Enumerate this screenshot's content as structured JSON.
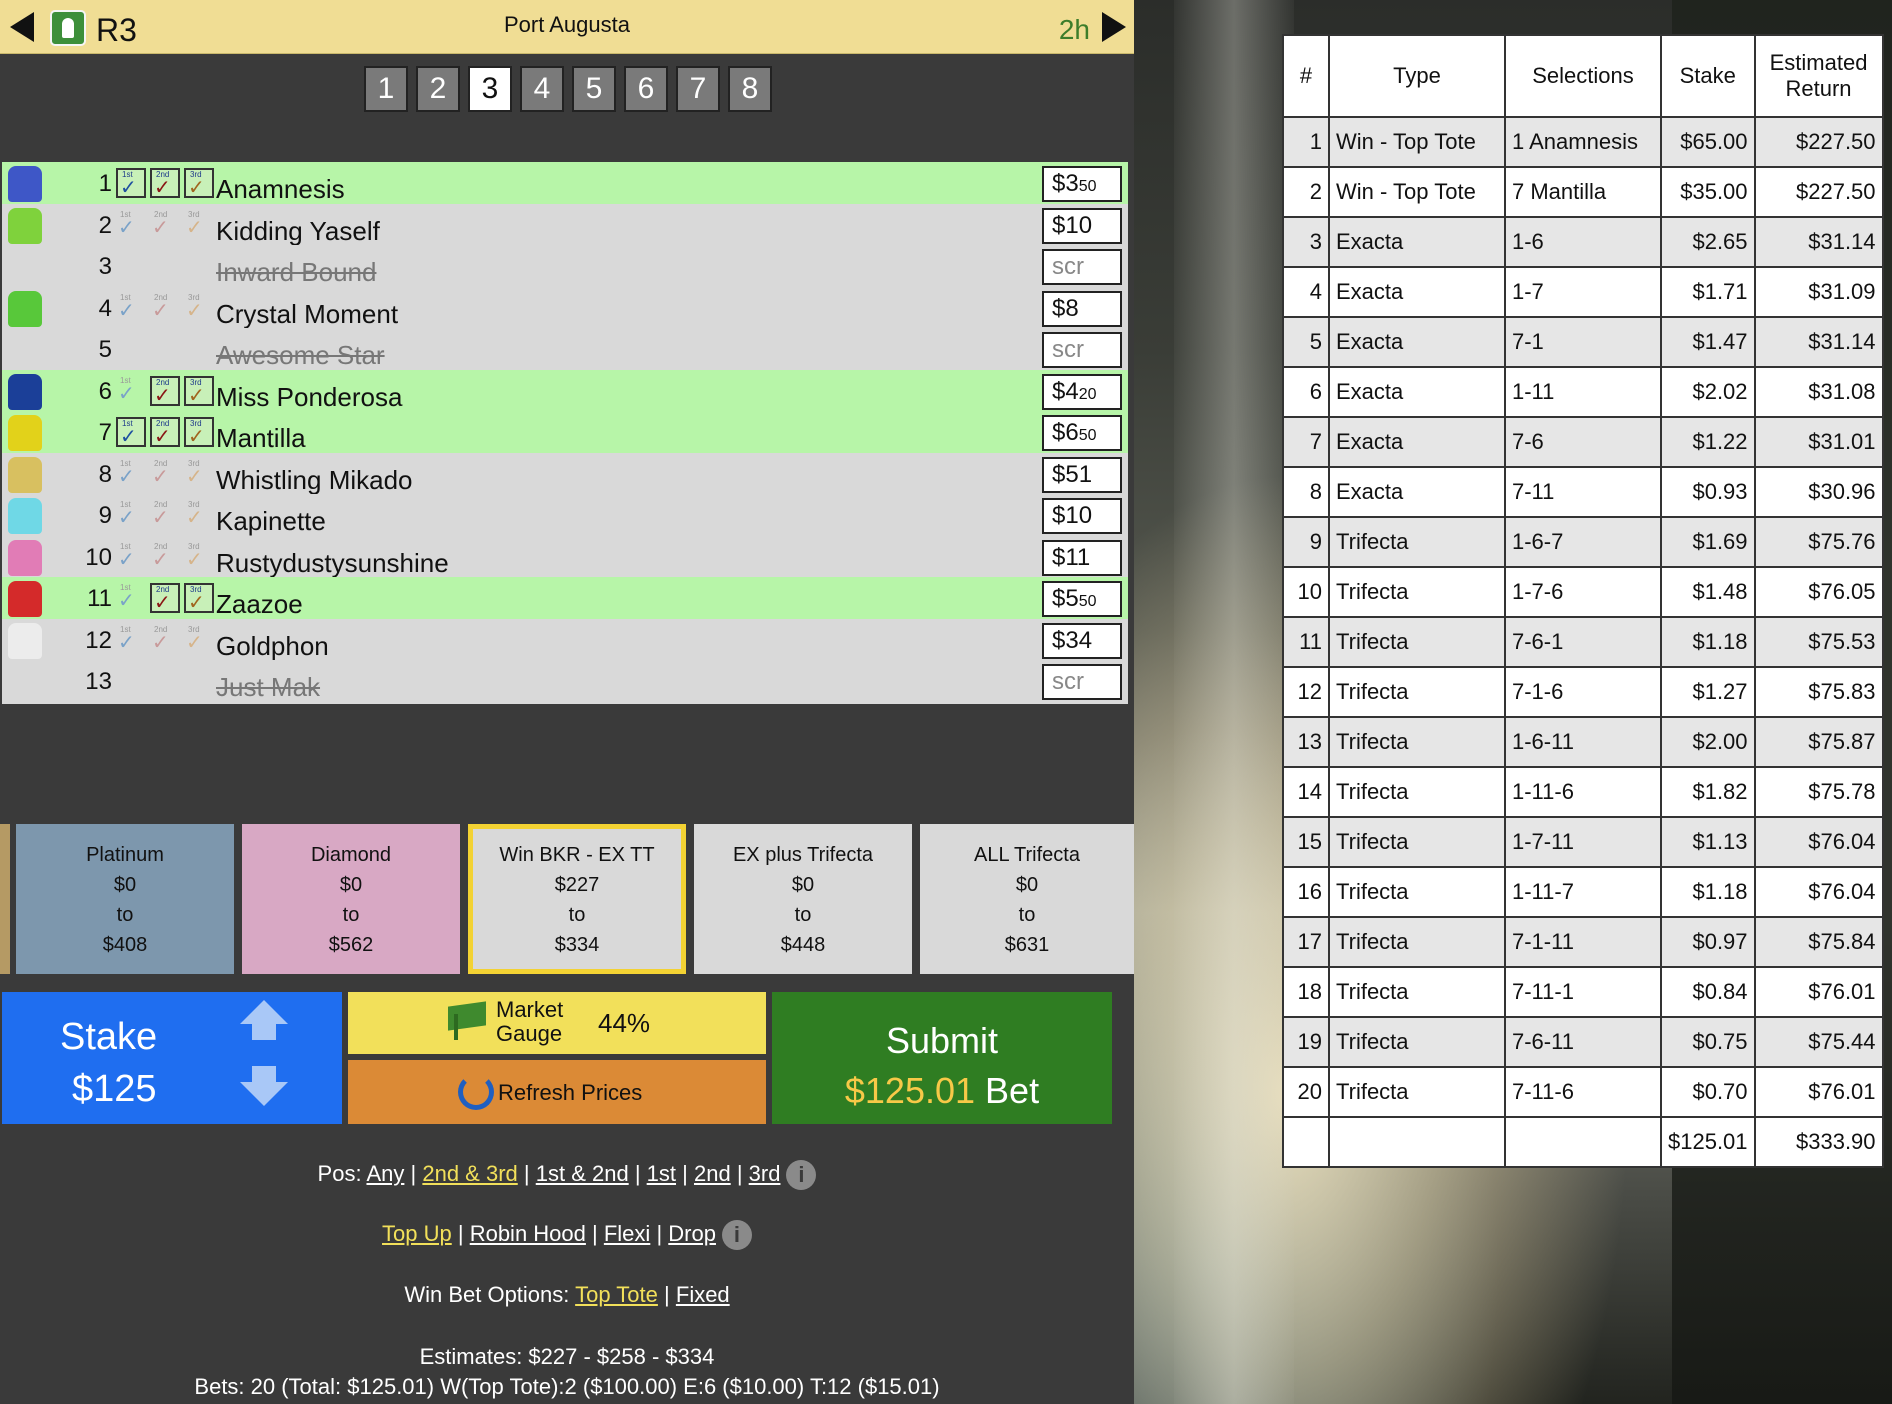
{
  "header": {
    "race_label": "R3",
    "venue": "Port Augusta",
    "time_to_start": "2h"
  },
  "race_tabs": [
    "1",
    "2",
    "3",
    "4",
    "5",
    "6",
    "7",
    "8"
  ],
  "active_race_index": 2,
  "check_labels": [
    "1st",
    "2nd",
    "3rd"
  ],
  "runners": [
    {
      "num": "1",
      "name": "Anamnesis",
      "price_main": "$3",
      "price_small": "50",
      "state": "sel",
      "checks": [
        true,
        true,
        true
      ],
      "silk": "#3e57c7"
    },
    {
      "num": "2",
      "name": "Kidding Yaself",
      "price_main": "$10",
      "price_small": "",
      "state": "",
      "checks": [
        false,
        false,
        false
      ],
      "silk": "#7fd23c"
    },
    {
      "num": "3",
      "name": "Inward Bound",
      "price_main": "scr",
      "price_small": "",
      "state": "scr",
      "checks": null,
      "silk": ""
    },
    {
      "num": "4",
      "name": "Crystal Moment",
      "price_main": "$8",
      "price_small": "",
      "state": "",
      "checks": [
        false,
        false,
        false
      ],
      "silk": "#58c83a"
    },
    {
      "num": "5",
      "name": "Awesome Star",
      "price_main": "scr",
      "price_small": "",
      "state": "scr",
      "checks": null,
      "silk": ""
    },
    {
      "num": "6",
      "name": "Miss Ponderosa",
      "price_main": "$4",
      "price_small": "20",
      "state": "sel",
      "checks": [
        false,
        true,
        true
      ],
      "silk": "#1b3f98"
    },
    {
      "num": "7",
      "name": "Mantilla",
      "price_main": "$6",
      "price_small": "50",
      "state": "sel",
      "checks": [
        true,
        true,
        true
      ],
      "silk": "#e2d21a"
    },
    {
      "num": "8",
      "name": "Whistling Mikado",
      "price_main": "$51",
      "price_small": "",
      "state": "",
      "checks": [
        false,
        false,
        false
      ],
      "silk": "#d8c060"
    },
    {
      "num": "9",
      "name": "Kapinette",
      "price_main": "$10",
      "price_small": "",
      "state": "",
      "checks": [
        false,
        false,
        false
      ],
      "silk": "#6fd8e6"
    },
    {
      "num": "10",
      "name": "Rustydustysunshine",
      "price_main": "$11",
      "price_small": "",
      "state": "",
      "checks": [
        false,
        false,
        false
      ],
      "silk": "#e17cb6"
    },
    {
      "num": "11",
      "name": "Zaazoe",
      "price_main": "$5",
      "price_small": "50",
      "state": "sel",
      "checks": [
        false,
        true,
        true
      ],
      "silk": "#d42a2a"
    },
    {
      "num": "12",
      "name": "Goldphon",
      "price_main": "$34",
      "price_small": "",
      "state": "",
      "checks": [
        false,
        false,
        false
      ],
      "silk": "#ececec"
    },
    {
      "num": "13",
      "name": "Just Mak",
      "price_main": "scr",
      "price_small": "",
      "state": "scr",
      "checks": null,
      "silk": ""
    }
  ],
  "bet_cards": [
    {
      "name": "Platinum",
      "from": "$0",
      "to_word": "to",
      "to": "$408"
    },
    {
      "name": "Diamond",
      "from": "$0",
      "to_word": "to",
      "to": "$562"
    },
    {
      "name": "Win BKR - EX TT",
      "from": "$227",
      "to_word": "to",
      "to": "$334"
    },
    {
      "name": "EX plus Trifecta",
      "from": "$0",
      "to_word": "to",
      "to": "$448"
    },
    {
      "name": "ALL Trifecta",
      "from": "$0",
      "to_word": "to",
      "to": "$631"
    }
  ],
  "stake": {
    "label": "Stake",
    "value": "$125"
  },
  "market_gauge": {
    "label_line1": "Market",
    "label_line2": "Gauge",
    "percent": "44%"
  },
  "refresh": {
    "label": "Refresh Prices"
  },
  "submit": {
    "label": "Submit",
    "amount": "$125.01",
    "suffix": "Bet"
  },
  "positions": {
    "prefix": "Pos:",
    "options": [
      {
        "label": "Any",
        "active": false
      },
      {
        "label": "2nd & 3rd",
        "active": true
      },
      {
        "label": "1st & 2nd",
        "active": false
      },
      {
        "label": "1st",
        "active": false
      },
      {
        "label": "2nd",
        "active": false
      },
      {
        "label": "3rd",
        "active": false
      }
    ]
  },
  "modes": {
    "options": [
      {
        "label": "Top Up",
        "active": true
      },
      {
        "label": "Robin Hood",
        "active": false
      },
      {
        "label": "Flexi",
        "active": false
      },
      {
        "label": "Drop",
        "active": false
      }
    ]
  },
  "win_options": {
    "prefix": "Win Bet Options:",
    "options": [
      {
        "label": "Top Tote",
        "active": true
      },
      {
        "label": "Fixed",
        "active": false
      }
    ]
  },
  "estimates": "Estimates: $227 - $258 - $334",
  "bets_summary": "Bets: 20 (Total: $125.01) W(Top Tote):2 ($100.00) E:6 ($10.00) T:12 ($15.01)",
  "info_glyph": "i",
  "separator": "|",
  "bet_table": {
    "headers": [
      "#",
      "Type",
      "Selections",
      "Stake",
      "Estimated Return"
    ],
    "rows": [
      [
        "1",
        "Win - Top Tote",
        "1 Anamnesis",
        "$65.00",
        "$227.50"
      ],
      [
        "2",
        "Win - Top Tote",
        "7 Mantilla",
        "$35.00",
        "$227.50"
      ],
      [
        "3",
        "Exacta",
        "1-6",
        "$2.65",
        "$31.14"
      ],
      [
        "4",
        "Exacta",
        "1-7",
        "$1.71",
        "$31.09"
      ],
      [
        "5",
        "Exacta",
        "7-1",
        "$1.47",
        "$31.14"
      ],
      [
        "6",
        "Exacta",
        "1-11",
        "$2.02",
        "$31.08"
      ],
      [
        "7",
        "Exacta",
        "7-6",
        "$1.22",
        "$31.01"
      ],
      [
        "8",
        "Exacta",
        "7-11",
        "$0.93",
        "$30.96"
      ],
      [
        "9",
        "Trifecta",
        "1-6-7",
        "$1.69",
        "$75.76"
      ],
      [
        "10",
        "Trifecta",
        "1-7-6",
        "$1.48",
        "$76.05"
      ],
      [
        "11",
        "Trifecta",
        "7-6-1",
        "$1.18",
        "$75.53"
      ],
      [
        "12",
        "Trifecta",
        "7-1-6",
        "$1.27",
        "$75.83"
      ],
      [
        "13",
        "Trifecta",
        "1-6-11",
        "$2.00",
        "$75.87"
      ],
      [
        "14",
        "Trifecta",
        "1-11-6",
        "$1.82",
        "$75.78"
      ],
      [
        "15",
        "Trifecta",
        "1-7-11",
        "$1.13",
        "$76.04"
      ],
      [
        "16",
        "Trifecta",
        "1-11-7",
        "$1.18",
        "$76.04"
      ],
      [
        "17",
        "Trifecta",
        "7-1-11",
        "$0.97",
        "$75.84"
      ],
      [
        "18",
        "Trifecta",
        "7-11-1",
        "$0.84",
        "$76.01"
      ],
      [
        "19",
        "Trifecta",
        "7-6-11",
        "$0.75",
        "$75.44"
      ],
      [
        "20",
        "Trifecta",
        "7-11-6",
        "$0.70",
        "$76.01"
      ]
    ],
    "totals": [
      "",
      "",
      "",
      "$125.01",
      "$333.90"
    ]
  },
  "colors": {
    "header_bg": "#f0dd94",
    "selected_row": "#b7f5a8",
    "stake_blue": "#1f6ef0",
    "submit_green": "#2f7d22",
    "gauge_yellow": "#f2e05a",
    "refresh_orange": "#db8a36",
    "active_link": "#f2e05a"
  }
}
